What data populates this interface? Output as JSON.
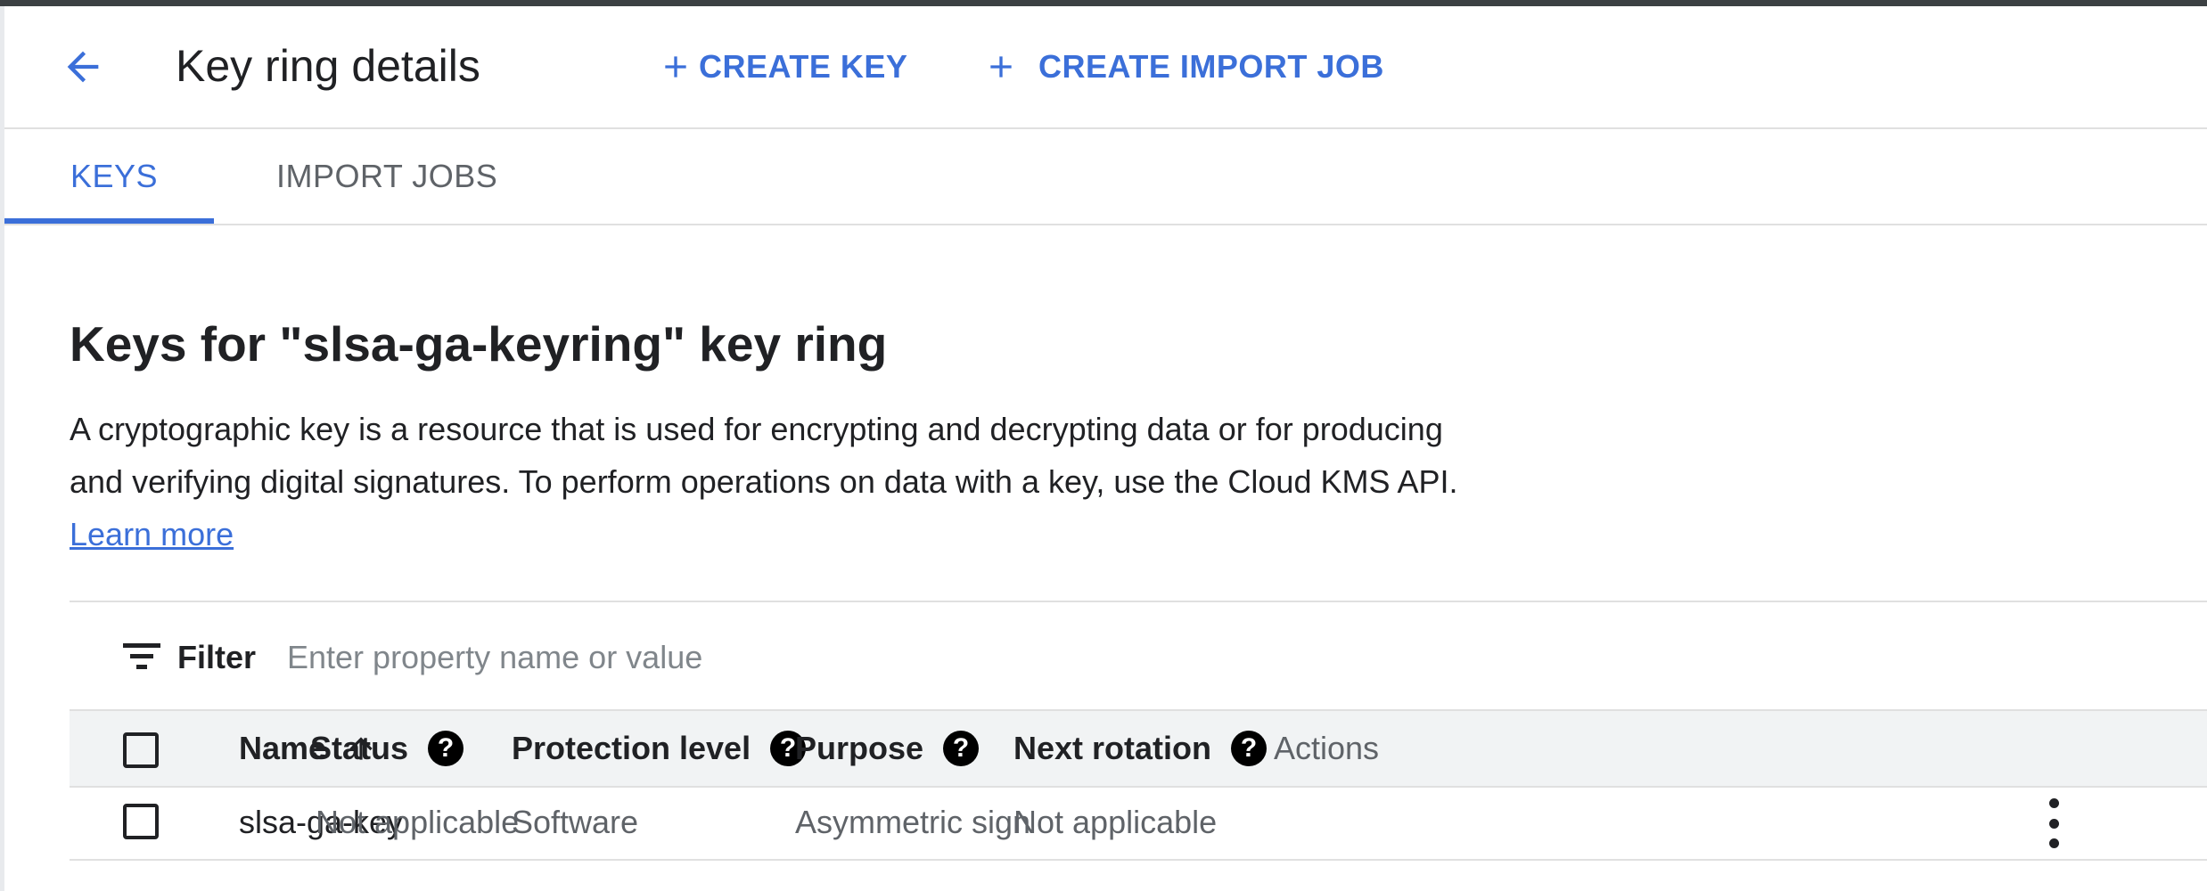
{
  "header": {
    "title": "Key ring details",
    "create_key_label": "CREATE KEY",
    "create_import_job_label": "CREATE IMPORT JOB"
  },
  "tabs": [
    {
      "label": "KEYS",
      "active": true
    },
    {
      "label": "IMPORT JOBS",
      "active": false
    }
  ],
  "section": {
    "title": "Keys for \"slsa-ga-keyring\" key ring",
    "description": "A cryptographic key is a resource that is used for encrypting and decrypting data or for producing and verifying digital signatures. To perform operations on data with a key, use the Cloud KMS API.",
    "learn_more": "Learn more"
  },
  "filter": {
    "label": "Filter",
    "placeholder": "Enter property name or value"
  },
  "table": {
    "columns": [
      "Name",
      "Status",
      "Protection level",
      "Purpose",
      "Next rotation",
      "Actions"
    ],
    "rows": [
      {
        "name": "slsa-ga-key",
        "status": "Not applicable",
        "protection_level": "Software",
        "purpose": "Asymmetric sign",
        "next_rotation": "Not applicable"
      }
    ]
  },
  "colors": {
    "accent": "#3b6fd9",
    "text_primary": "#202124",
    "text_secondary": "#5f6368",
    "header_row_bg": "#f1f3f4"
  },
  "icons": {
    "back": "arrow-left-icon",
    "plus": "plus-icon",
    "filter": "filter-icon",
    "sort": "arrow-up-icon",
    "help": "help-circle-icon",
    "more": "more-vert-icon"
  }
}
